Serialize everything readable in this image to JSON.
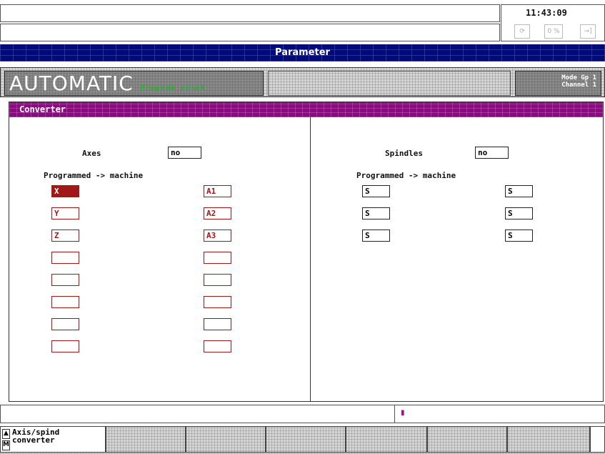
{
  "header": {
    "time": "11:43:09",
    "status_icons": [
      "refresh-icon",
      "percent-icon",
      "exit-icon"
    ],
    "status_icon_text": [
      "⟳",
      "0 %",
      "→]"
    ]
  },
  "title_bar": {
    "label": "Parameter"
  },
  "mode_bar": {
    "mode": "AUTOMATIC",
    "state": "Program reset",
    "group_line1": "Mode Gp 1",
    "group_line2": "Channel 1"
  },
  "window": {
    "title": "Converter",
    "left": {
      "axes_label": "Axes",
      "axes_value": "no",
      "heading": "Programmed -> machine",
      "programmed": [
        "X",
        "Y",
        "Z",
        "",
        "",
        "",
        "",
        ""
      ],
      "machine": [
        "A1",
        "A2",
        "A3",
        "",
        "",
        "",
        "",
        ""
      ]
    },
    "right": {
      "spindles_label": "Spindles",
      "spindles_value": "no",
      "heading": "Programmed -> machine",
      "programmed": [
        "S",
        "S",
        "S"
      ],
      "machine": [
        "S",
        "S",
        "S"
      ]
    }
  },
  "status_line": {
    "left_text": "",
    "cursor_marker": "▮"
  },
  "softkeys": {
    "arrow_up": "▲",
    "arrow_m": "M",
    "key1": "Axis/spind\nconverter"
  },
  "colors": {
    "title_bar": "#000a7a",
    "window_bar": "#8a0a80",
    "field_red": "#a01818",
    "status_green": "#10c020"
  }
}
